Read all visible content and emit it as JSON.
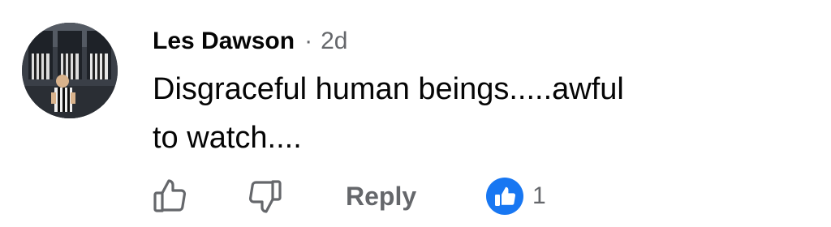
{
  "comment": {
    "author": "Les Dawson",
    "separator": "·",
    "timestamp": "2d",
    "text_lines": [
      "Disgraceful human beings.....awful",
      "to watch...."
    ]
  },
  "actions": {
    "like_icon": "thumbs-up-outline-icon",
    "dislike_icon": "thumbs-down-outline-icon",
    "reply_label": "Reply"
  },
  "reactions": {
    "icon": "like-reaction-badge-icon",
    "count": "1"
  },
  "colors": {
    "primary_text": "#050505",
    "secondary_text": "#65676b",
    "reaction_blue": "#1877f2"
  }
}
